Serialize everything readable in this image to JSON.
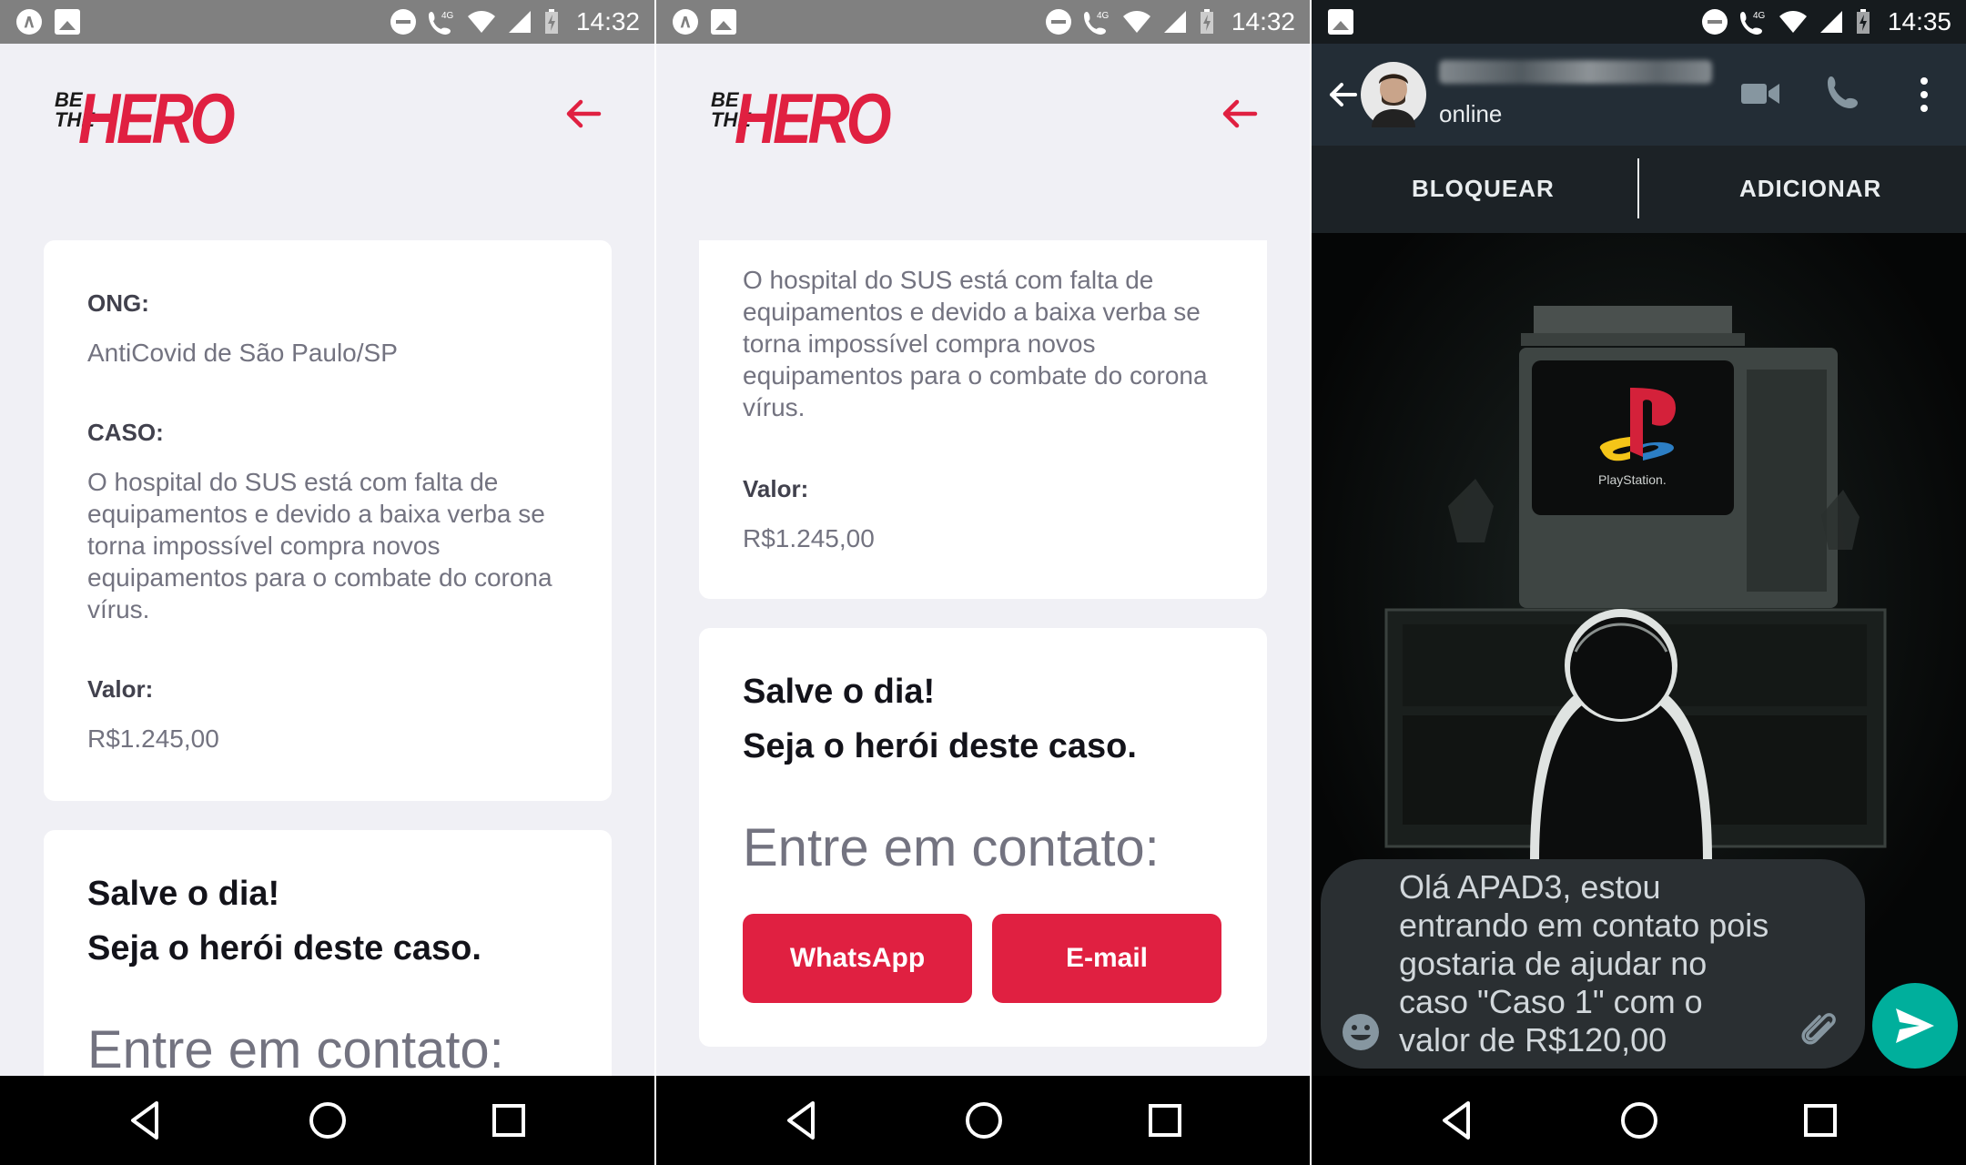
{
  "status_time_1": "14:32",
  "status_time_2": "14:32",
  "status_time_3": "14:35",
  "network": "4G",
  "logo": {
    "be_the": "BE THE",
    "hero": "HERO"
  },
  "colors": {
    "accent": "#e02041",
    "background": "#f0f0f5",
    "status_bar": "#808080",
    "whatsapp_header": "#232d36",
    "whatsapp_green": "#00af9c"
  },
  "screen1": {
    "ong_label": "ONG:",
    "ong_value": "AntiCovid de São Paulo/SP",
    "caso_label": "CASO:",
    "caso_value": "O hospital do SUS está com falta de equipamentos e devido a baixa verba se torna impossível compra novos equipamentos para o combate do corona vírus.",
    "valor_label": "Valor:",
    "valor_value": "R$1.245,00",
    "heading_1": "Salve o dia!",
    "heading_2": "Seja o herói deste caso.",
    "contact": "Entre em contato:"
  },
  "screen2": {
    "caso_value": "O hospital do SUS está com falta de equipamentos e devido a baixa verba se torna impossível compra novos equipamentos para o combate do corona vírus.",
    "valor_label": "Valor:",
    "valor_value": "R$1.245,00",
    "heading_1": "Salve o dia!",
    "heading_2": "Seja o herói deste caso.",
    "contact": "Entre em contato:",
    "whatsapp_button": "WhatsApp",
    "email_button": "E-mail"
  },
  "screen3": {
    "contact_status": "online",
    "block_button": "BLOQUEAR",
    "add_button": "ADICIONAR",
    "message": "Olá APAD3, estou entrando em contato pois gostaria de ajudar no caso \"Caso 1\" com o valor de R$120,00",
    "wallpaper_text": "PlayStation."
  }
}
